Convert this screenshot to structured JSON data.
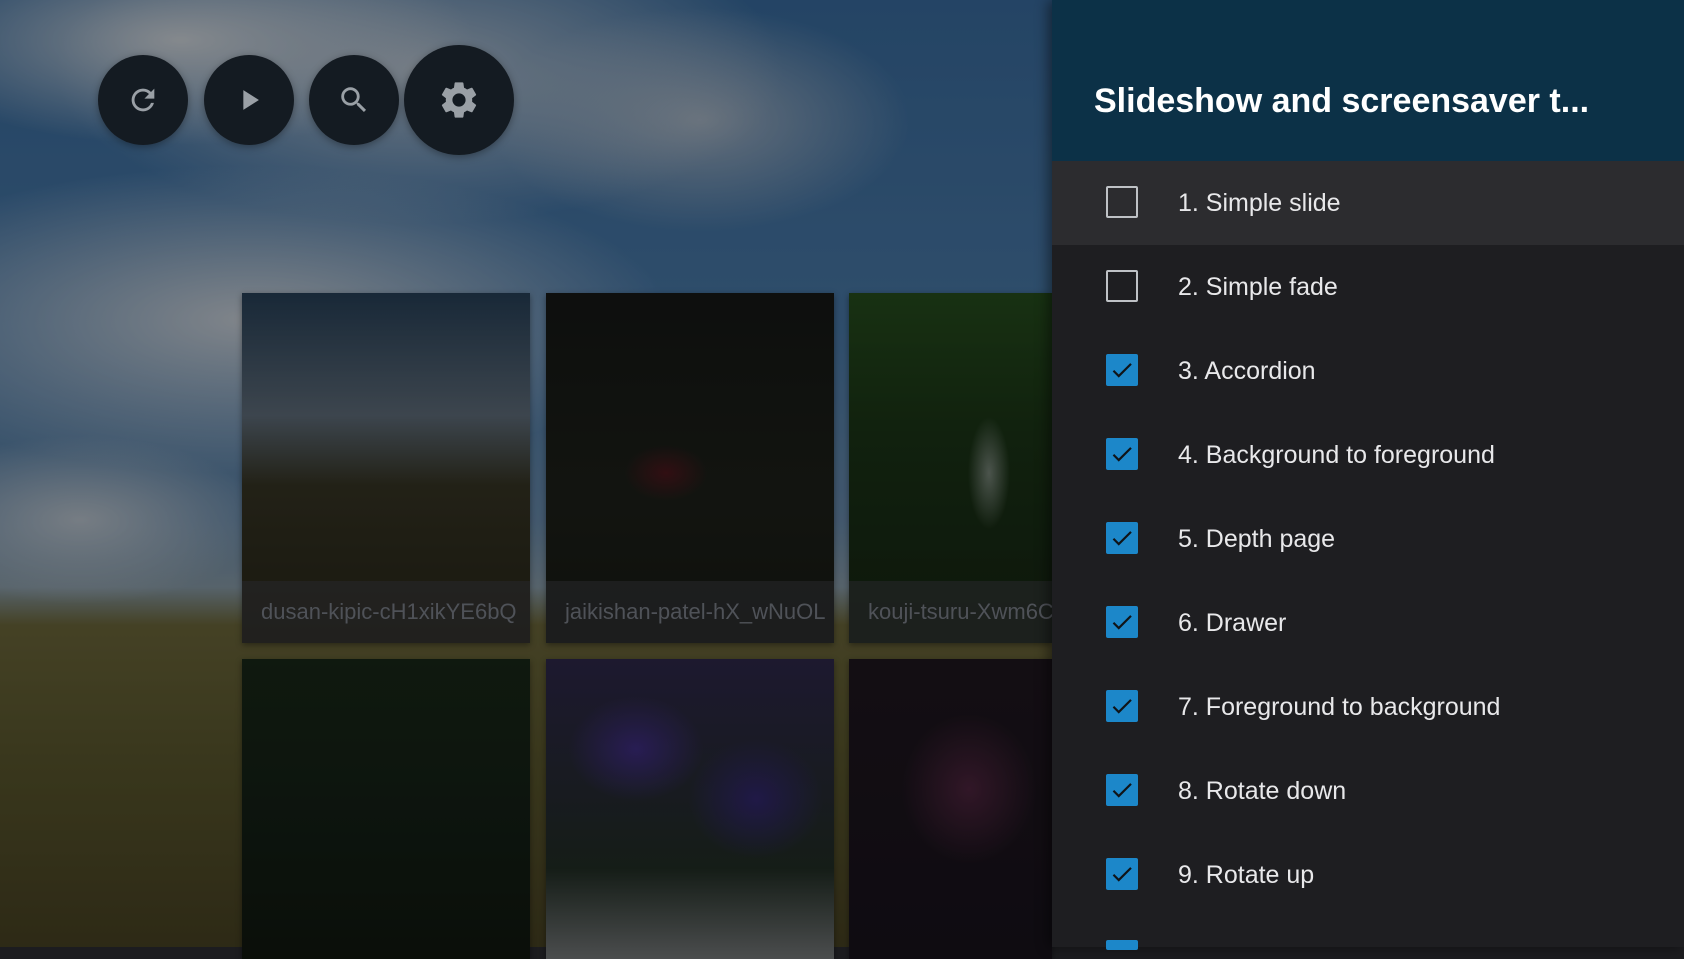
{
  "toolbar": {
    "buttons": [
      {
        "name": "refresh",
        "icon": "refresh-icon"
      },
      {
        "name": "play",
        "icon": "play-icon"
      },
      {
        "name": "search",
        "icon": "search-icon"
      },
      {
        "name": "settings",
        "icon": "gear-icon"
      }
    ]
  },
  "gallery": {
    "tiles": [
      {
        "caption": "dusan-kipic-cH1xikYE6bQ"
      },
      {
        "caption": "jaikishan-patel-hX_wNuOL"
      },
      {
        "caption": "kouji-tsuru-Xwm6C"
      },
      {
        "caption": ""
      },
      {
        "caption": ""
      },
      {
        "caption": ""
      }
    ]
  },
  "panel": {
    "title": "Slideshow and screensaver t...",
    "items": [
      {
        "label": "1. Simple slide",
        "checked": false,
        "focused": true
      },
      {
        "label": "2. Simple fade",
        "checked": false
      },
      {
        "label": "3. Accordion",
        "checked": true
      },
      {
        "label": "4. Background to foreground",
        "checked": true
      },
      {
        "label": "5. Depth page",
        "checked": true
      },
      {
        "label": "6. Drawer",
        "checked": true
      },
      {
        "label": "7. Foreground to background",
        "checked": true
      },
      {
        "label": "8. Rotate down",
        "checked": true
      },
      {
        "label": "9. Rotate up",
        "checked": true
      }
    ]
  },
  "colors": {
    "header_bg": "#0c3147",
    "panel_bg": "#1e1e21",
    "checkbox_accent": "#1c87c9"
  }
}
